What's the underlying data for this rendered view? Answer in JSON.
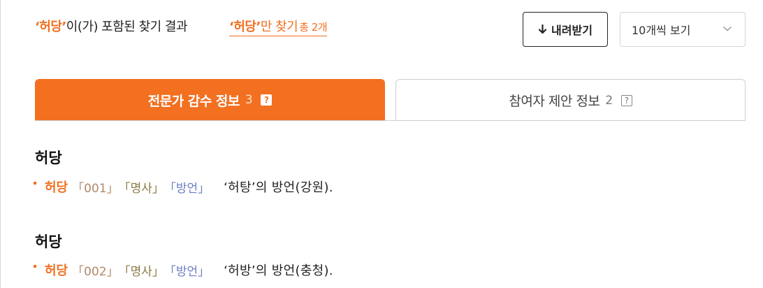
{
  "result": {
    "keyword": "‘허당’",
    "suffix": "이(가) 포함된 찾기 결과",
    "exact_keyword": "‘허당’",
    "exact_suffix": "만 찾기",
    "total": "총 2개"
  },
  "toolbar": {
    "download_label": "내려받기",
    "per_page_value": "10개씩 보기"
  },
  "tabs": [
    {
      "label": "전문가 감수 정보",
      "count": "3",
      "help": "?"
    },
    {
      "label": "참여자 제안 정보",
      "count": "2",
      "help": "?"
    }
  ],
  "entries": [
    {
      "title": "허당",
      "headword": "허당",
      "number": "「001」",
      "pos": "「명사」",
      "region": "「방언」",
      "definition": "‘허탕’의 방언(강원)."
    },
    {
      "title": "허당",
      "headword": "허당",
      "number": "「002」",
      "pos": "「명사」",
      "region": "「방언」",
      "definition": "‘허방’의 방언(충청)."
    }
  ],
  "colors": {
    "accent": "#f37021",
    "pos_tag": "#8a7a44",
    "region_tag": "#6d7fc2",
    "number_tag": "#b08968"
  },
  "icons": {
    "download": "arrow-down-icon",
    "select": "chevron-down-icon",
    "help": "question-box-icon"
  }
}
